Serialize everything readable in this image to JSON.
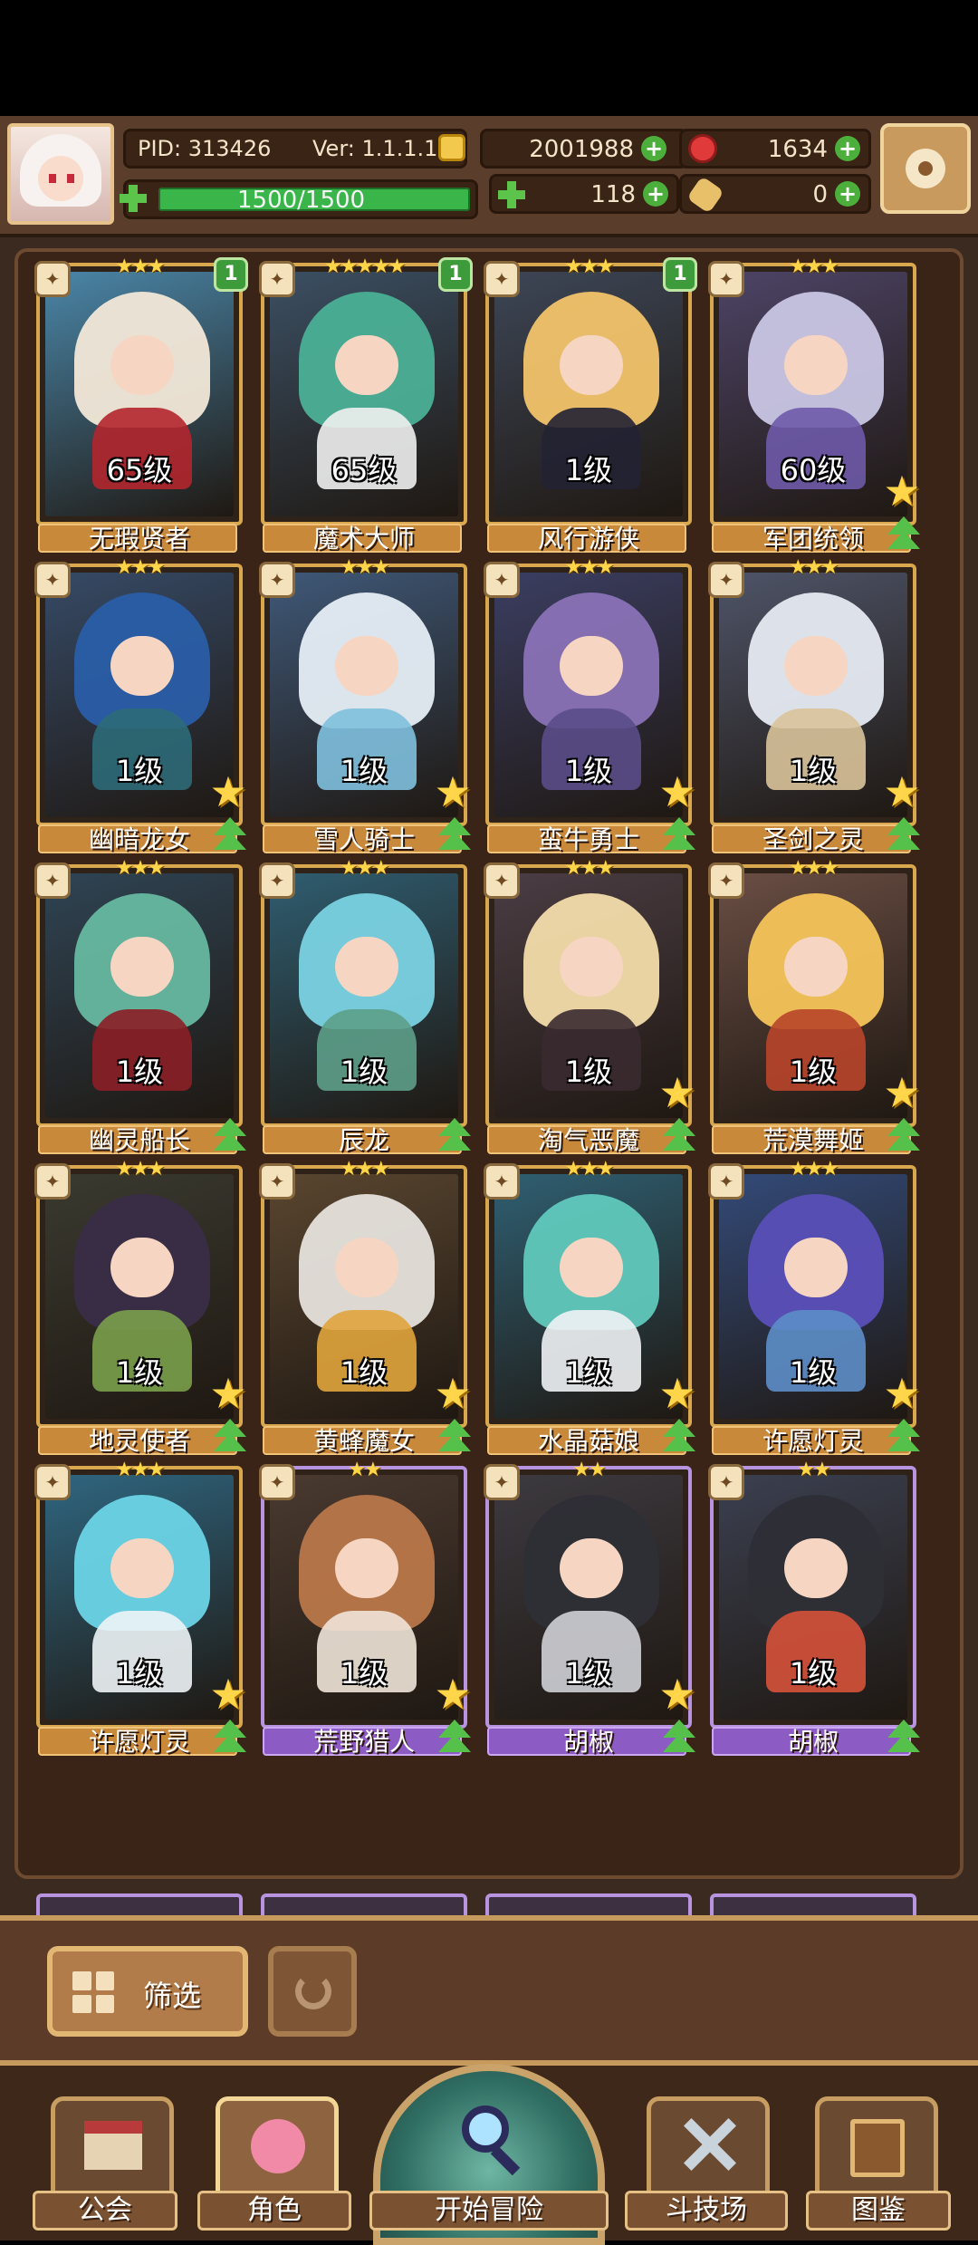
{
  "header": {
    "pid": "PID: 313426",
    "version": "Ver: 1.1.1.1",
    "gold": "2001988",
    "gems": "1634",
    "clover": "118",
    "bones": "0",
    "xp_text": "1500/1500",
    "xp_fraction": 1.0
  },
  "icons": {
    "settings": "gear-icon",
    "gold": "coin-icon",
    "gems": "ruby-icon",
    "clover": "clover-icon",
    "bones": "bone-icon",
    "xp": "plus-cross-icon"
  },
  "roster": [
    {
      "name": "无瑕贤者",
      "level": "65级",
      "stars": 3,
      "badge": "1",
      "rarity": "gold",
      "hair": "#f2e8d8",
      "body": "#b2262e",
      "bg": "#4a86a8"
    },
    {
      "name": "魔术大师",
      "level": "65级",
      "stars": 5,
      "badge": "1",
      "rarity": "gold",
      "hair": "#4bb096",
      "body": "#f0f0f0",
      "bg": "#3b4f63"
    },
    {
      "name": "风行游侠",
      "level": "1级",
      "stars": 3,
      "badge": "1",
      "rarity": "gold",
      "hair": "#f2c36a",
      "body": "#222233",
      "bg": "#3d4656"
    },
    {
      "name": "军团统领",
      "level": "60级",
      "stars": 3,
      "badge": "",
      "rarity": "gold",
      "hair": "#c9c6e4",
      "body": "#6e5aa8",
      "bg": "#4d4466",
      "bigstar": true,
      "up": true
    },
    {
      "name": "幽暗龙女",
      "level": "1级",
      "stars": 3,
      "badge": "",
      "rarity": "gold",
      "hair": "#2a5ea8",
      "body": "#2d6a78",
      "bg": "#364a66",
      "bigstar": true,
      "up": true
    },
    {
      "name": "雪人骑士",
      "level": "1级",
      "stars": 3,
      "badge": "",
      "rarity": "gold",
      "hair": "#e6eef6",
      "body": "#7fc0de",
      "bg": "#3f5878",
      "bigstar": true,
      "up": true
    },
    {
      "name": "蛮牛勇士",
      "level": "1级",
      "stars": 3,
      "badge": "",
      "rarity": "gold",
      "hair": "#8a72b6",
      "body": "#5a4c88",
      "bg": "#3b3e62",
      "bigstar": true,
      "up": true
    },
    {
      "name": "圣剑之灵",
      "level": "1级",
      "stars": 3,
      "badge": "",
      "rarity": "gold",
      "hair": "#e6eaf2",
      "body": "#d9c39a",
      "bg": "#4e5468",
      "bigstar": true,
      "up": true
    },
    {
      "name": "幽灵船长",
      "level": "1级",
      "stars": 3,
      "badge": "",
      "rarity": "gold",
      "hair": "#66b8a0",
      "body": "#8b1f26",
      "bg": "#2f4454",
      "up": true
    },
    {
      "name": "辰龙",
      "level": "1级",
      "stars": 3,
      "badge": "",
      "rarity": "gold",
      "hair": "#7ad2e2",
      "body": "#5d9e88",
      "bg": "#2f5d70",
      "up": true
    },
    {
      "name": "淘气恶魔",
      "level": "1级",
      "stars": 3,
      "badge": "",
      "rarity": "gold",
      "hair": "#f3dcaa",
      "body": "#3a2a30",
      "bg": "#4b3d44",
      "bigstar": true,
      "up": true
    },
    {
      "name": "荒漠舞姬",
      "level": "1级",
      "stars": 3,
      "badge": "",
      "rarity": "gold",
      "hair": "#f6c45a",
      "body": "#b8452a",
      "bg": "#6a4e44",
      "bigstar": true,
      "up": true
    },
    {
      "name": "地灵使者",
      "level": "1级",
      "stars": 3,
      "badge": "",
      "rarity": "gold",
      "hair": "#3a2d48",
      "body": "#7aa04a",
      "bg": "#3a3a30",
      "bigstar": true,
      "up": true
    },
    {
      "name": "黄蜂魔女",
      "level": "1级",
      "stars": 3,
      "badge": "",
      "rarity": "gold",
      "hair": "#e6e2dc",
      "body": "#e0a43c",
      "bg": "#5a4630",
      "bigstar": true,
      "up": true
    },
    {
      "name": "水晶菇娘",
      "level": "1级",
      "stars": 3,
      "badge": "",
      "rarity": "gold",
      "hair": "#60c8bc",
      "body": "#f0f2f4",
      "bg": "#2f5f72",
      "bigstar": true,
      "up": true
    },
    {
      "name": "许愿灯灵",
      "level": "1级",
      "stars": 3,
      "badge": "",
      "rarity": "gold",
      "hair": "#5a4fb8",
      "body": "#5d8ec8",
      "bg": "#334a78",
      "bigstar": true,
      "up": true
    },
    {
      "name": "许愿灯灵",
      "level": "1级",
      "stars": 3,
      "badge": "",
      "rarity": "gold",
      "hair": "#6ad4e6",
      "body": "#eef4f6",
      "bg": "#2f6680",
      "bigstar": true,
      "up": true
    },
    {
      "name": "荒野猎人",
      "level": "1级",
      "stars": 2,
      "badge": "",
      "rarity": "purple",
      "hair": "#b9774a",
      "body": "#efe4d8",
      "bg": "#4a3a30",
      "bigstar": true,
      "up": true
    },
    {
      "name": "胡椒",
      "level": "1级",
      "stars": 2,
      "badge": "",
      "rarity": "purple",
      "hair": "#2e2e36",
      "body": "#cfd0d6",
      "bg": "#3d3a40",
      "bigstar": true,
      "up": true
    },
    {
      "name": "胡椒",
      "level": "1级",
      "stars": 2,
      "badge": "",
      "rarity": "purple",
      "hair": "#2e2e36",
      "body": "#d6523a",
      "bg": "#3b4050",
      "up": true
    }
  ],
  "controls": {
    "filter_label": "筛选",
    "refresh_icon": "refresh-icon"
  },
  "nav": [
    {
      "label": "公会",
      "icon": "guild-hall-icon"
    },
    {
      "label": "角色",
      "icon": "character-icon"
    },
    {
      "label": "开始冒险",
      "icon": "magnifier-icon"
    },
    {
      "label": "斗技场",
      "icon": "crossed-swords-icon"
    },
    {
      "label": "图鉴",
      "icon": "book-icon"
    }
  ]
}
